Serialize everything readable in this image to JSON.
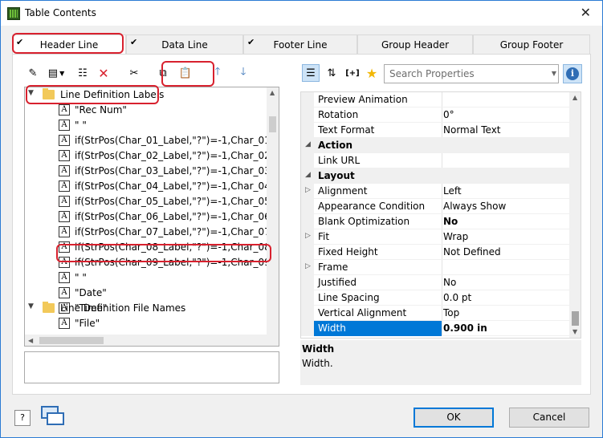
{
  "window": {
    "title": "Table Contents",
    "close": "✕"
  },
  "tabs": [
    {
      "label": "Header Line",
      "checked": true,
      "active": true
    },
    {
      "label": "Data Line",
      "checked": true
    },
    {
      "label": "Footer Line",
      "checked": true
    },
    {
      "label": "Group Header",
      "checked": false
    },
    {
      "label": "Group Footer",
      "checked": false
    }
  ],
  "tree": {
    "folders": [
      {
        "label": "Line Definition Labels"
      },
      {
        "label": "Line Definition File Names"
      }
    ],
    "items": [
      "\"Rec Num\"",
      "\" \"",
      "if(StrPos(Char_01_Label,\"?\")=-1,Char_01_Labe",
      "if(StrPos(Char_02_Label,\"?\")=-1,Char_02_Labe",
      "if(StrPos(Char_03_Label,\"?\")=-1,Char_03_Labe",
      "if(StrPos(Char_04_Label,\"?\")=-1,Char_04_Labe",
      "if(StrPos(Char_05_Label,\"?\")=-1,Char_05_Labe",
      "if(StrPos(Char_06_Label,\"?\")=-1,Char_06_Labe",
      "if(StrPos(Char_07_Label,\"?\")=-1,Char_07_Labe",
      "if(StrPos(Char_08_Label,\"?\")=-1,Char_08_Labe",
      "if(StrPos(Char_09_Label,\"?\")=-1,Char_09_Labe",
      "\" \"",
      "\"Date\"",
      "\"Time\"",
      "\"File\""
    ],
    "field_glyph": "A",
    "selected_item": "if(StrPos(Char_09_Label,\"?\")=-1,Char_09_Labe"
  },
  "properties": {
    "search_placeholder": "Search Properties",
    "rows": [
      {
        "name": "Preview Animation",
        "value": ""
      },
      {
        "name": "Rotation",
        "value": "0°"
      },
      {
        "name": "Text Format",
        "value": "Normal Text"
      },
      {
        "name": "Action",
        "value": ""
      },
      {
        "name": "Link URL",
        "value": ""
      },
      {
        "name": "Layout",
        "value": ""
      },
      {
        "name": "Alignment",
        "value": "Left"
      },
      {
        "name": "Appearance Condition",
        "value": "Always Show"
      },
      {
        "name": "Blank Optimization",
        "value": "No"
      },
      {
        "name": "Fit",
        "value": "Wrap"
      },
      {
        "name": "Fixed Height",
        "value": "Not Defined"
      },
      {
        "name": "Frame",
        "value": ""
      },
      {
        "name": "Justified",
        "value": "No"
      },
      {
        "name": "Line Spacing",
        "value": "0.0 pt"
      },
      {
        "name": "Vertical Alignment",
        "value": "Top"
      },
      {
        "name": "Width",
        "value": "0.900 in"
      }
    ],
    "help_title": "Width",
    "help_text": "Width."
  },
  "buttons": {
    "ok": "OK",
    "cancel": "Cancel",
    "help": "?"
  },
  "colors": {
    "highlight": "#d8212e",
    "selection": "#0078d7"
  }
}
